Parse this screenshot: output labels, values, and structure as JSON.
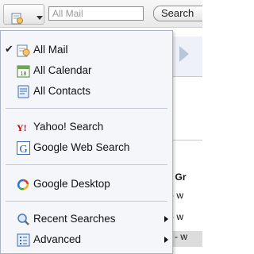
{
  "toolbar": {
    "scope_button_icon": "document-search-icon",
    "search_placeholder": "All Mail",
    "search_button_label": "Search"
  },
  "background": {
    "rows": [
      {
        "text": "'O Gr",
        "style": "bold"
      },
      {
        "text": "e - w",
        "style": "normal"
      },
      {
        "text": "e - w",
        "style": "normal"
      },
      {
        "text": "e - w",
        "style": "selected"
      }
    ]
  },
  "menu": {
    "items": [
      {
        "name": "all-mail",
        "label": "All Mail",
        "icon": "mail-folder-icon",
        "checked": true,
        "submenu": false
      },
      {
        "name": "all-calendar",
        "label": "All Calendar",
        "icon": "calendar-icon",
        "checked": false,
        "submenu": false
      },
      {
        "name": "all-contacts",
        "label": "All Contacts",
        "icon": "contacts-icon",
        "checked": false,
        "submenu": false
      },
      {
        "name": "yahoo-search",
        "label": "Yahoo! Search",
        "icon": "yahoo-icon",
        "checked": false,
        "submenu": false
      },
      {
        "name": "google-web-search",
        "label": "Google Web Search",
        "icon": "google-icon",
        "checked": false,
        "submenu": false
      },
      {
        "name": "google-desktop",
        "label": "Google Desktop",
        "icon": "google-desktop-icon",
        "checked": false,
        "submenu": false
      },
      {
        "name": "recent-searches",
        "label": "Recent Searches",
        "icon": "magnifier-icon",
        "checked": false,
        "submenu": true
      },
      {
        "name": "advanced",
        "label": "Advanced",
        "icon": "advanced-list-icon",
        "checked": false,
        "submenu": true
      }
    ],
    "check_glyph": "✔"
  },
  "colors": {
    "menu_background": "#f4f6fa",
    "menu_border": "#a9b3c2",
    "accent_blue": "#3a78c8"
  }
}
